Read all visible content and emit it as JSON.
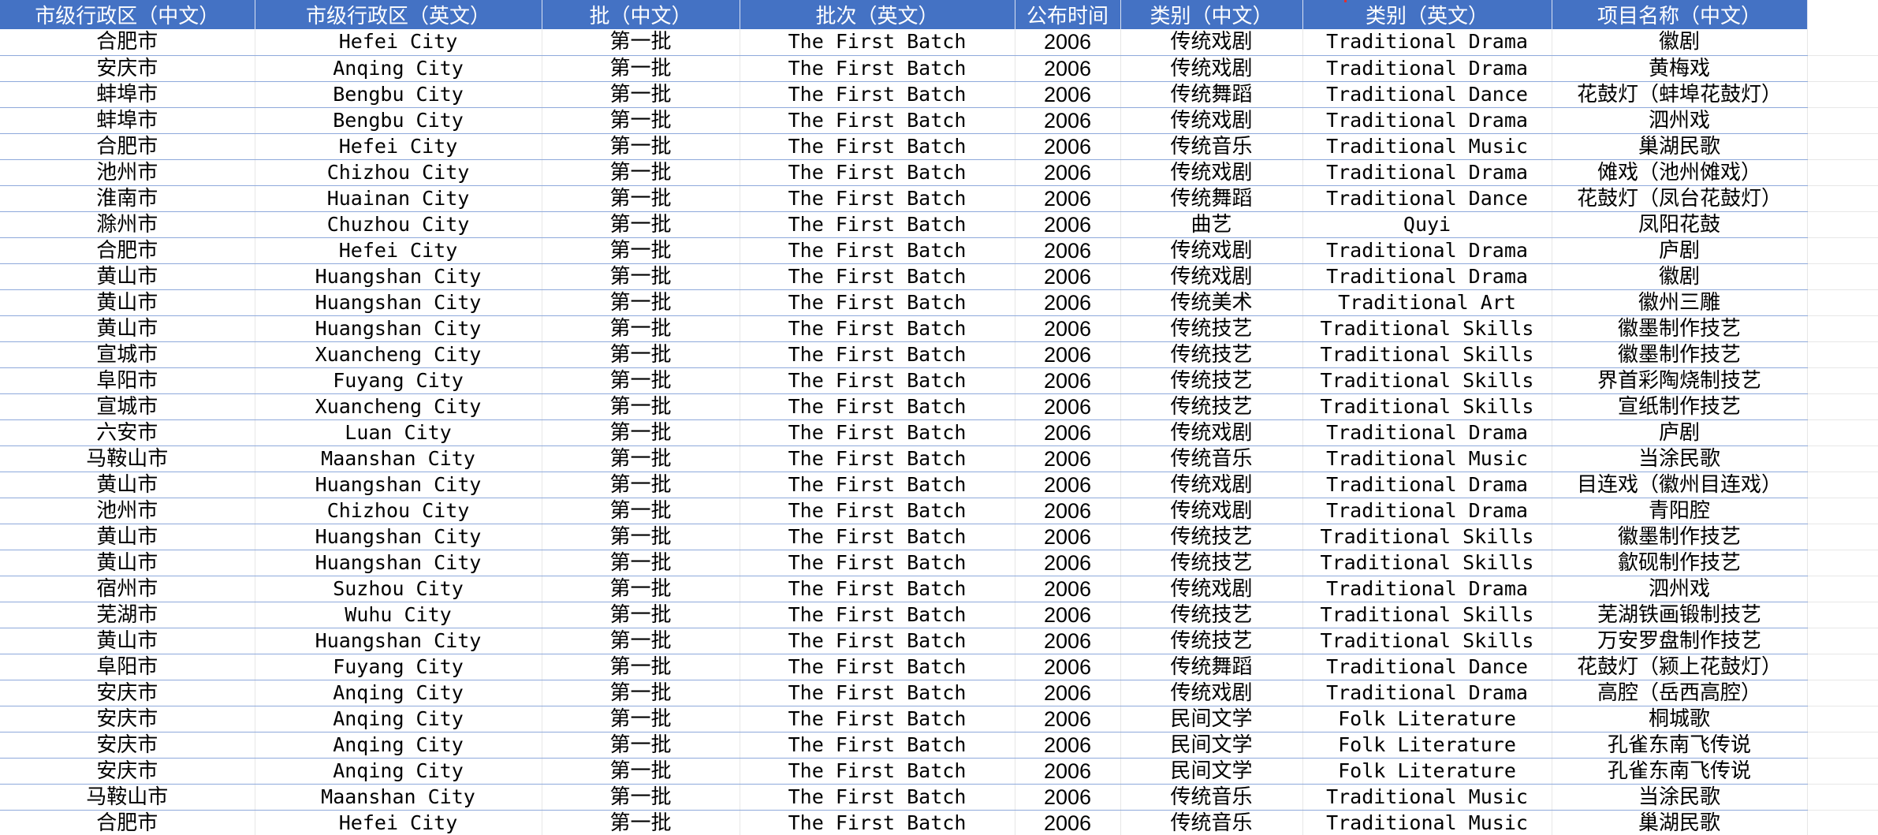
{
  "sheet": {
    "headers": [
      "市级行政区（中文）",
      "市级行政区（英文）",
      "批（中文）",
      "批次（英文）",
      "公布时间",
      "类别（中文）",
      "类别（英文）",
      "项目名称（中文）"
    ],
    "rows": [
      [
        "合肥市",
        "Hefei City",
        "第一批",
        "The First Batch",
        "2006",
        "传统戏剧",
        "Traditional Drama",
        "徽剧"
      ],
      [
        "安庆市",
        "Anqing City",
        "第一批",
        "The First Batch",
        "2006",
        "传统戏剧",
        "Traditional Drama",
        "黄梅戏"
      ],
      [
        "蚌埠市",
        "Bengbu City",
        "第一批",
        "The First Batch",
        "2006",
        "传统舞蹈",
        "Traditional Dance",
        "花鼓灯（蚌埠花鼓灯）"
      ],
      [
        "蚌埠市",
        "Bengbu City",
        "第一批",
        "The First Batch",
        "2006",
        "传统戏剧",
        "Traditional Drama",
        "泗州戏"
      ],
      [
        "合肥市",
        "Hefei City",
        "第一批",
        "The First Batch",
        "2006",
        "传统音乐",
        "Traditional Music",
        "巢湖民歌"
      ],
      [
        "池州市",
        "Chizhou City",
        "第一批",
        "The First Batch",
        "2006",
        "传统戏剧",
        "Traditional Drama",
        "傩戏（池州傩戏）"
      ],
      [
        "淮南市",
        "Huainan City",
        "第一批",
        "The First Batch",
        "2006",
        "传统舞蹈",
        "Traditional Dance",
        "花鼓灯（凤台花鼓灯）"
      ],
      [
        "滁州市",
        "Chuzhou City",
        "第一批",
        "The First Batch",
        "2006",
        "曲艺",
        "Quyi",
        "凤阳花鼓"
      ],
      [
        "合肥市",
        "Hefei City",
        "第一批",
        "The First Batch",
        "2006",
        "传统戏剧",
        "Traditional Drama",
        "庐剧"
      ],
      [
        "黄山市",
        "Huangshan City",
        "第一批",
        "The First Batch",
        "2006",
        "传统戏剧",
        "Traditional Drama",
        "徽剧"
      ],
      [
        "黄山市",
        "Huangshan City",
        "第一批",
        "The First Batch",
        "2006",
        "传统美术",
        "Traditional Art",
        "徽州三雕"
      ],
      [
        "黄山市",
        "Huangshan City",
        "第一批",
        "The First Batch",
        "2006",
        "传统技艺",
        "Traditional Skills",
        "徽墨制作技艺"
      ],
      [
        "宣城市",
        "Xuancheng City",
        "第一批",
        "The First Batch",
        "2006",
        "传统技艺",
        "Traditional Skills",
        "徽墨制作技艺"
      ],
      [
        "阜阳市",
        "Fuyang City",
        "第一批",
        "The First Batch",
        "2006",
        "传统技艺",
        "Traditional Skills",
        "界首彩陶烧制技艺"
      ],
      [
        "宣城市",
        "Xuancheng City",
        "第一批",
        "The First Batch",
        "2006",
        "传统技艺",
        "Traditional Skills",
        "宣纸制作技艺"
      ],
      [
        "六安市",
        "Luan City",
        "第一批",
        "The First Batch",
        "2006",
        "传统戏剧",
        "Traditional Drama",
        "庐剧"
      ],
      [
        "马鞍山市",
        "Maanshan City",
        "第一批",
        "The First Batch",
        "2006",
        "传统音乐",
        "Traditional Music",
        "当涂民歌"
      ],
      [
        "黄山市",
        "Huangshan City",
        "第一批",
        "The First Batch",
        "2006",
        "传统戏剧",
        "Traditional Drama",
        "目连戏（徽州目连戏）"
      ],
      [
        "池州市",
        "Chizhou City",
        "第一批",
        "The First Batch",
        "2006",
        "传统戏剧",
        "Traditional Drama",
        "青阳腔"
      ],
      [
        "黄山市",
        "Huangshan City",
        "第一批",
        "The First Batch",
        "2006",
        "传统技艺",
        "Traditional Skills",
        "徽墨制作技艺"
      ],
      [
        "黄山市",
        "Huangshan City",
        "第一批",
        "The First Batch",
        "2006",
        "传统技艺",
        "Traditional Skills",
        "歙砚制作技艺"
      ],
      [
        "宿州市",
        "Suzhou City",
        "第一批",
        "The First Batch",
        "2006",
        "传统戏剧",
        "Traditional Drama",
        "泗州戏"
      ],
      [
        "芜湖市",
        "Wuhu City",
        "第一批",
        "The First Batch",
        "2006",
        "传统技艺",
        "Traditional Skills",
        "芜湖铁画锻制技艺"
      ],
      [
        "黄山市",
        "Huangshan City",
        "第一批",
        "The First Batch",
        "2006",
        "传统技艺",
        "Traditional Skills",
        "万安罗盘制作技艺"
      ],
      [
        "阜阳市",
        "Fuyang City",
        "第一批",
        "The First Batch",
        "2006",
        "传统舞蹈",
        "Traditional Dance",
        "花鼓灯（颍上花鼓灯）"
      ],
      [
        "安庆市",
        "Anqing City",
        "第一批",
        "The First Batch",
        "2006",
        "传统戏剧",
        "Traditional Drama",
        "高腔（岳西高腔）"
      ],
      [
        "安庆市",
        "Anqing City",
        "第一批",
        "The First Batch",
        "2006",
        "民间文学",
        "Folk Literature",
        "桐城歌"
      ],
      [
        "安庆市",
        "Anqing City",
        "第一批",
        "The First Batch",
        "2006",
        "民间文学",
        "Folk Literature",
        "孔雀东南飞传说"
      ],
      [
        "安庆市",
        "Anqing City",
        "第一批",
        "The First Batch",
        "2006",
        "民间文学",
        "Folk Literature",
        "孔雀东南飞传说"
      ],
      [
        "马鞍山市",
        "Maanshan City",
        "第一批",
        "The First Batch",
        "2006",
        "传统音乐",
        "Traditional Music",
        "当涂民歌"
      ],
      [
        "合肥市",
        "Hefei City",
        "第一批",
        "The First Batch",
        "2006",
        "传统音乐",
        "Traditional Music",
        "巢湖民歌"
      ]
    ]
  }
}
